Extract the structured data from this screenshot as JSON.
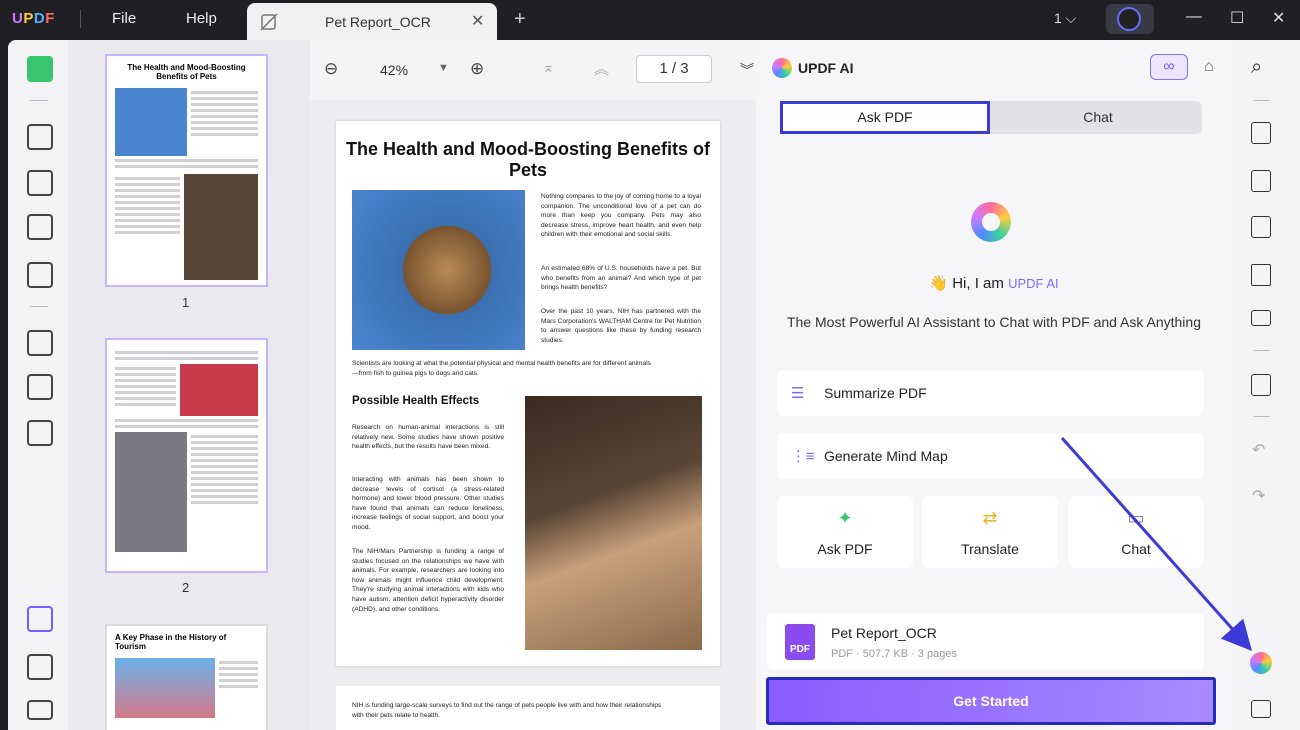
{
  "app": {
    "logo": "UPDF",
    "menu": [
      "File",
      "Help"
    ],
    "tab_title": "Pet Report_OCR",
    "page_count_label": "1"
  },
  "viewer": {
    "zoom": "42%",
    "page_indicator": "1 / 3"
  },
  "thumbnails": [
    {
      "num": "1",
      "title": "The Health and Mood-Boosting Benefits of Pets"
    },
    {
      "num": "2",
      "title": ""
    },
    {
      "num": "",
      "title": "A Key Phase in the History of Tourism"
    }
  ],
  "document": {
    "title": "The Health and Mood-Boosting Benefits of Pets",
    "intro1": "Nothing compares to the joy of coming home to a loyal companion. The unconditional love of a pet can do more than keep you company. Pets may also decrease stress, improve heart health, and even help children with their emotional and social skills.",
    "intro2": "An estimated 68% of U.S. households have a pet. But who benefits from an animal? And which type of pet brings health benefits?",
    "intro3": "Over the past 10 years, NIH has partnered with the Mars Corporation's WALTHAM Centre for Pet Nutrition to answer questions like these by funding research studies.",
    "caption": "Scientists are looking at what the potential physical and mental health benefits are for different animals—from fish to guinea pigs to dogs and cats.",
    "section": "Possible Health Effects",
    "p1": "Research on human-animal interactions is still relatively new. Some studies have shown positive health effects, but the results have been mixed.",
    "p2": "Interacting with animals has been shown to decrease levels of cortisol (a stress-related hormone) and lower blood pressure. Other studies have found that animals can reduce loneliness, increase feelings of social support, and boost your mood.",
    "p3": "The NIH/Mars Partnership is funding a range of studies focused on the relationships we have with animals. For example, researchers are looking into how animals might influence child development. They're studying animal interactions with kids who have autism, attention deficit hyperactivity disorder (ADHD), and other conditions.",
    "page2_text": "NIH is funding large-scale surveys to find out the range of pets people live with and how their relationships with their pets relate to health."
  },
  "ai": {
    "title": "UPDF AI",
    "tab_ask": "Ask PDF",
    "tab_chat": "Chat",
    "greeting": "Hi, I am",
    "greeting_name": "UPDF AI",
    "subtitle": "The Most Powerful AI Assistant to Chat with PDF and Ask Anything",
    "actions": [
      "Summarize PDF",
      "Generate Mind Map"
    ],
    "cards": [
      "Ask PDF",
      "Translate",
      "Chat"
    ],
    "file_name": "Pet Report_OCR",
    "file_meta": "PDF · 507.7 KB · 3 pages",
    "button": "Get Started",
    "accent": "#7a6cff"
  }
}
